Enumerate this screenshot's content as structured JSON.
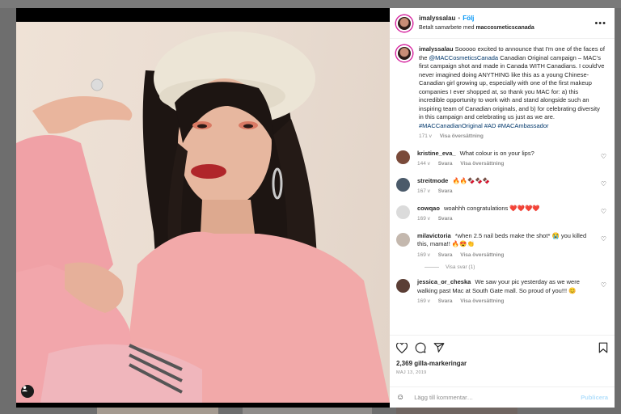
{
  "colors": {
    "accent": "#0095f6",
    "link": "#00376b",
    "muted": "#8e8e8e",
    "heart": "#c0392b"
  },
  "header": {
    "username": "imalyssalau",
    "separator": "•",
    "follow_label": "Följ",
    "sponsor_prefix": "Betalt samarbete med",
    "sponsor_partner": "maccosmeticscanada",
    "more_icon": "more-horizontal-icon"
  },
  "caption": {
    "username": "imalyssalau",
    "text_1": "Sooooo excited to announce that I'm one of the faces of the",
    "mention_1": "@MACCosmeticsCanada",
    "text_2": "Canadian Original campaign – MAC's first campaign shot and made in Canada WITH Canadians. I could've never imagined doing ANYTHING like this as a young Chinese-Canadian girl growing up, especially with one of the first makeup companies I ever shopped at, so thank you MAC for: a) this incredible opportunity to work with and stand alongside such an inspiring team of Canadian originals, and b) for celebrating diversity in this campaign and celebrating us just as we are.",
    "hashtags": "#MACCanadianOriginal #AD #MACAmbassador",
    "time": "171 v",
    "translate": "Visa översättning"
  },
  "comments": [
    {
      "username": "kristine_eva_",
      "text": "What colour is on your lips?",
      "time": "144 v",
      "reply": "Svara",
      "translate": "Visa översättning",
      "avatar_color": "#7a4a3a"
    },
    {
      "username": "streitmode",
      "text": "🔥🔥🍫🍫🍫",
      "time": "167 v",
      "reply": "Svara",
      "translate": "",
      "avatar_color": "#4a5a6a"
    },
    {
      "username": "cowqao",
      "text": "woahhh congratulations ❤️❤️❤️❤️",
      "time": "169 v",
      "reply": "Svara",
      "translate": "",
      "avatar_color": "#dbdbdb"
    },
    {
      "username": "milavictoria",
      "text": "*when 2.5 nail beds make the shot* 😭 you killed this, mama!! 🔥😍👏",
      "time": "169 v",
      "reply": "Svara",
      "translate": "Visa översättning",
      "avatar_color": "#c4b8ae"
    },
    {
      "username": "jessica_or_cheska",
      "text": "We saw your pic yesterday as we were walking past Mac at South Gate mall. So proud of you!!! 😊",
      "time": "169 v",
      "reply": "Svara",
      "translate": "Visa översättning",
      "avatar_color": "#5b3e35"
    }
  ],
  "view_replies": "Visa svar (1)",
  "actions": {
    "icons": [
      "heart-icon",
      "comment-icon",
      "share-icon",
      "bookmark-icon"
    ],
    "likes": "2,369 gilla-markeringar",
    "date": "MAJ 13, 2019"
  },
  "add_comment": {
    "placeholder": "Lägg till kommentar…",
    "publish": "Publicera",
    "emoji_icon": "emoji-icon"
  }
}
